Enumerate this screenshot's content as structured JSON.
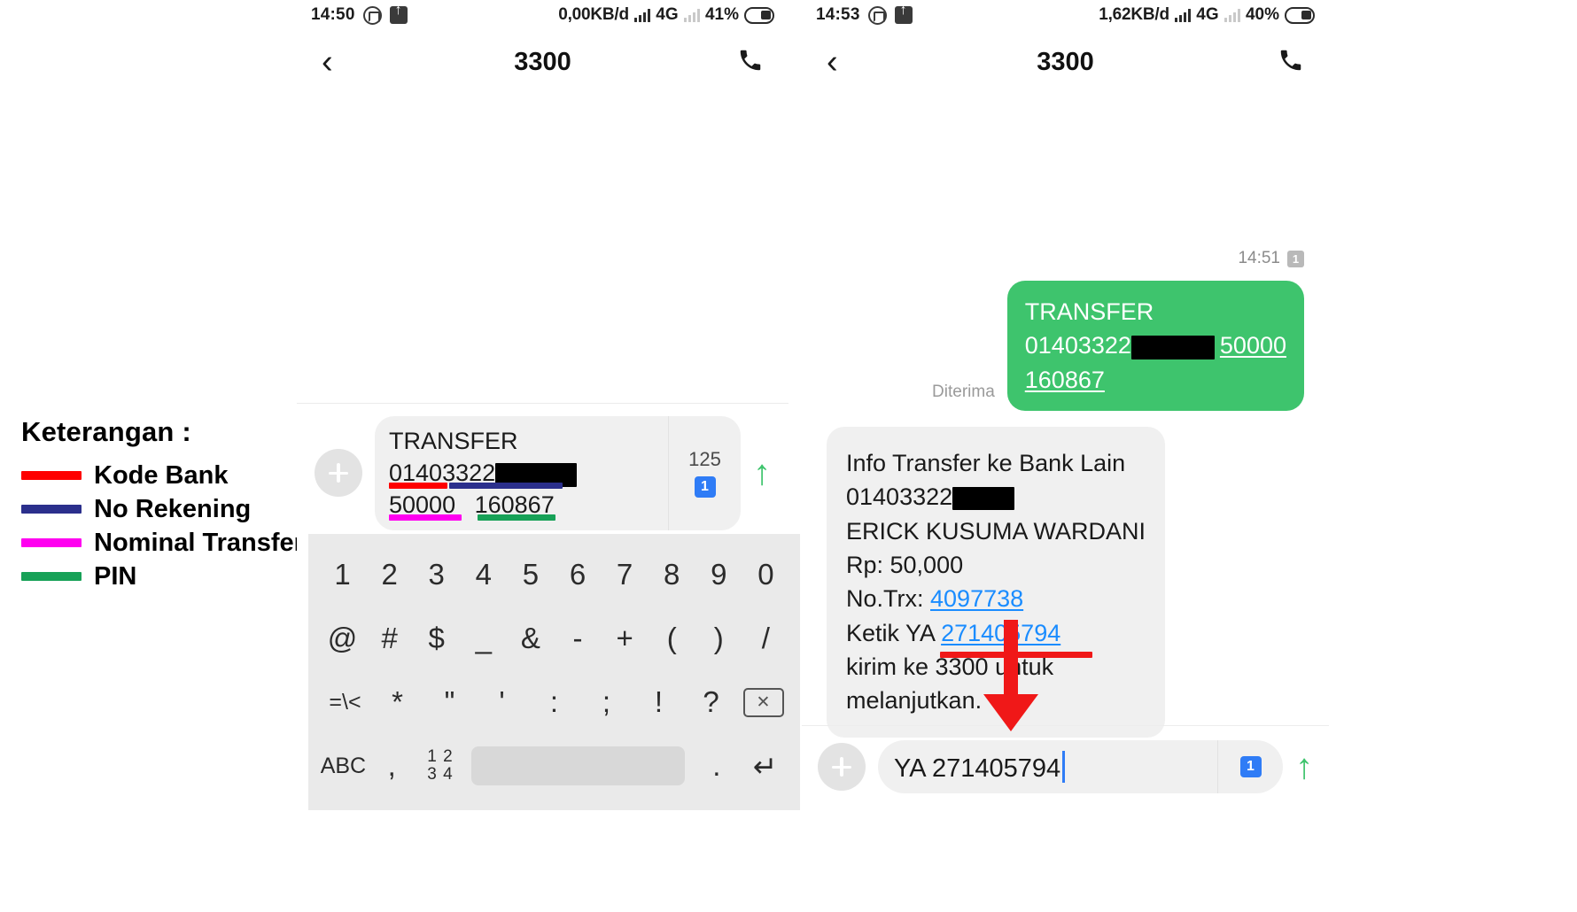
{
  "legend": {
    "title": "Keterangan :",
    "items": [
      {
        "label": "Kode Bank",
        "color": "#fe0000"
      },
      {
        "label": "No Rekening",
        "color": "#2b2f8c"
      },
      {
        "label": "Nominal Transfer",
        "color": "#ff00f0"
      },
      {
        "label": "PIN",
        "color": "#17a157"
      }
    ]
  },
  "phone_left": {
    "status": {
      "clock": "14:50",
      "whatsapp_icon": "whatsapp-icon",
      "upload_icon": "upload-icon",
      "data_speed": "0,00KB/d",
      "network": "4G",
      "battery_pct": "41%"
    },
    "nav": {
      "back_icon": "chevron-left-icon",
      "title": "3300",
      "call_icon": "phone-icon"
    },
    "compose": {
      "plus_icon": "plus-icon",
      "line1": "TRANSFER",
      "bank_code": "01403322",
      "redacted": "",
      "amount": "50000",
      "pin": "160867",
      "char_count": "125",
      "sim_badge": "1",
      "send_icon": "send-arrow-icon"
    },
    "keyboard": {
      "row1": [
        "1",
        "2",
        "3",
        "4",
        "5",
        "6",
        "7",
        "8",
        "9",
        "0"
      ],
      "row2": [
        "@",
        "#",
        "$",
        "_",
        "&",
        "-",
        "+",
        "(",
        ")",
        "/"
      ],
      "row3": [
        "=\\<",
        "*",
        "\"",
        "'",
        ":",
        ";",
        "!",
        "?"
      ],
      "row3_delete_icon": "backspace-icon",
      "row4_abc": "ABC",
      "row4_comma": ",",
      "row4_num": "1234",
      "row4_space": "",
      "row4_period": ".",
      "row4_enter_icon": "enter-icon"
    }
  },
  "phone_right": {
    "status": {
      "clock": "14:53",
      "whatsapp_icon": "whatsapp-icon",
      "upload_icon": "upload-icon",
      "data_speed": "1,62KB/d",
      "network": "4G",
      "battery_pct": "40%"
    },
    "nav": {
      "back_icon": "chevron-left-icon",
      "title": "3300",
      "call_icon": "phone-icon"
    },
    "timestamp": "14:51",
    "timestamp_sim": "1",
    "sent_bubble": {
      "status_label": "Diterima",
      "line1": "TRANSFER",
      "bank_code": "01403322",
      "amount": "50000",
      "pin": "160867"
    },
    "reply_bubble": {
      "line1": "Info Transfer ke Bank Lain",
      "account": "01403322",
      "name": "ERICK KUSUMA WARDANI",
      "amount": "Rp: 50,000",
      "trx_label": "No.Trx:",
      "trx_value": "4097738",
      "ketik_label": "Ketik YA",
      "ketik_value": "271405794",
      "line_kirim": "kirim ke 3300 untuk",
      "line_lanjut": "melanjutkan."
    },
    "compose": {
      "plus_icon": "plus-icon",
      "value": "YA 271405794",
      "sim_badge": "1",
      "send_icon": "send-arrow-icon"
    }
  },
  "colors": {
    "green_bubble": "#3ec46d",
    "grey_bubble": "#f0f0f0",
    "link_blue": "#1a8cff",
    "annotation_red": "#f01818"
  }
}
